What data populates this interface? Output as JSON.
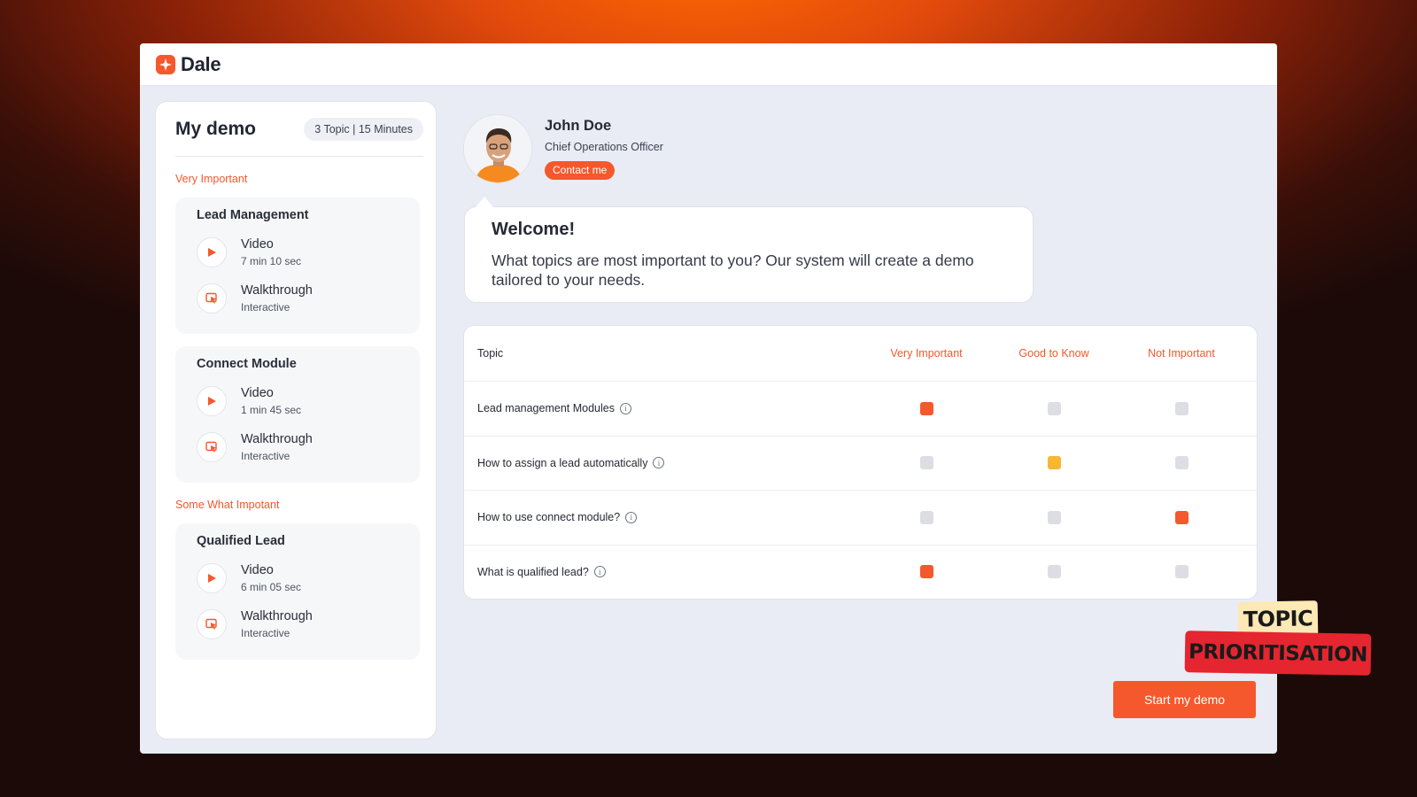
{
  "app": {
    "name": "Dale",
    "accent": "#f5582c"
  },
  "sidebar": {
    "title": "My demo",
    "summary": "3 Topic | 15 Minutes",
    "sections": [
      {
        "label": "Very Important",
        "cards": [
          {
            "title": "Lead Management",
            "items": [
              {
                "type": "video",
                "title": "Video",
                "sub": "7 min 10 sec",
                "icon": "play-icon"
              },
              {
                "type": "walkthrough",
                "title": "Walkthrough",
                "sub": "Interactive",
                "icon": "cursor-screen-icon"
              }
            ]
          },
          {
            "title": "Connect Module",
            "items": [
              {
                "type": "video",
                "title": "Video",
                "sub": "1 min 45 sec",
                "icon": "play-icon"
              },
              {
                "type": "walkthrough",
                "title": "Walkthrough",
                "sub": "Interactive",
                "icon": "cursor-screen-icon"
              }
            ]
          }
        ]
      },
      {
        "label": "Some What Impotant",
        "cards": [
          {
            "title": "Qualified Lead",
            "items": [
              {
                "type": "video",
                "title": "Video",
                "sub": "6 min 05 sec",
                "icon": "play-icon"
              },
              {
                "type": "walkthrough",
                "title": "Walkthrough",
                "sub": "Interactive",
                "icon": "cursor-screen-icon"
              }
            ]
          }
        ]
      }
    ]
  },
  "profile": {
    "name": "John Doe",
    "role": "Chief Operations Officer",
    "contact_label": "Contact me"
  },
  "welcome": {
    "title": "Welcome!",
    "text": "What topics are most important to you? Our system will create a demo tailored to your needs."
  },
  "table": {
    "headers": [
      "Topic",
      "Very Important",
      "Good to Know",
      "Not Important"
    ],
    "rows": [
      {
        "topic": "Lead management Modules",
        "selected": "Very Important"
      },
      {
        "topic": "How to assign a lead automatically",
        "selected": "Good to Know"
      },
      {
        "topic": "How to use connect module?",
        "selected": "Not Important"
      },
      {
        "topic": "What is qualified lead?",
        "selected": "Very Important"
      }
    ],
    "colors": {
      "Very Important": "#f5582c",
      "Good to Know": "#f7b733",
      "Not Important": "#f5582c",
      "unselected": "#dcdee3"
    }
  },
  "start_label": "Start my demo",
  "sticker": {
    "line1": "TOPIC",
    "line2": "PRIORITISATION"
  }
}
